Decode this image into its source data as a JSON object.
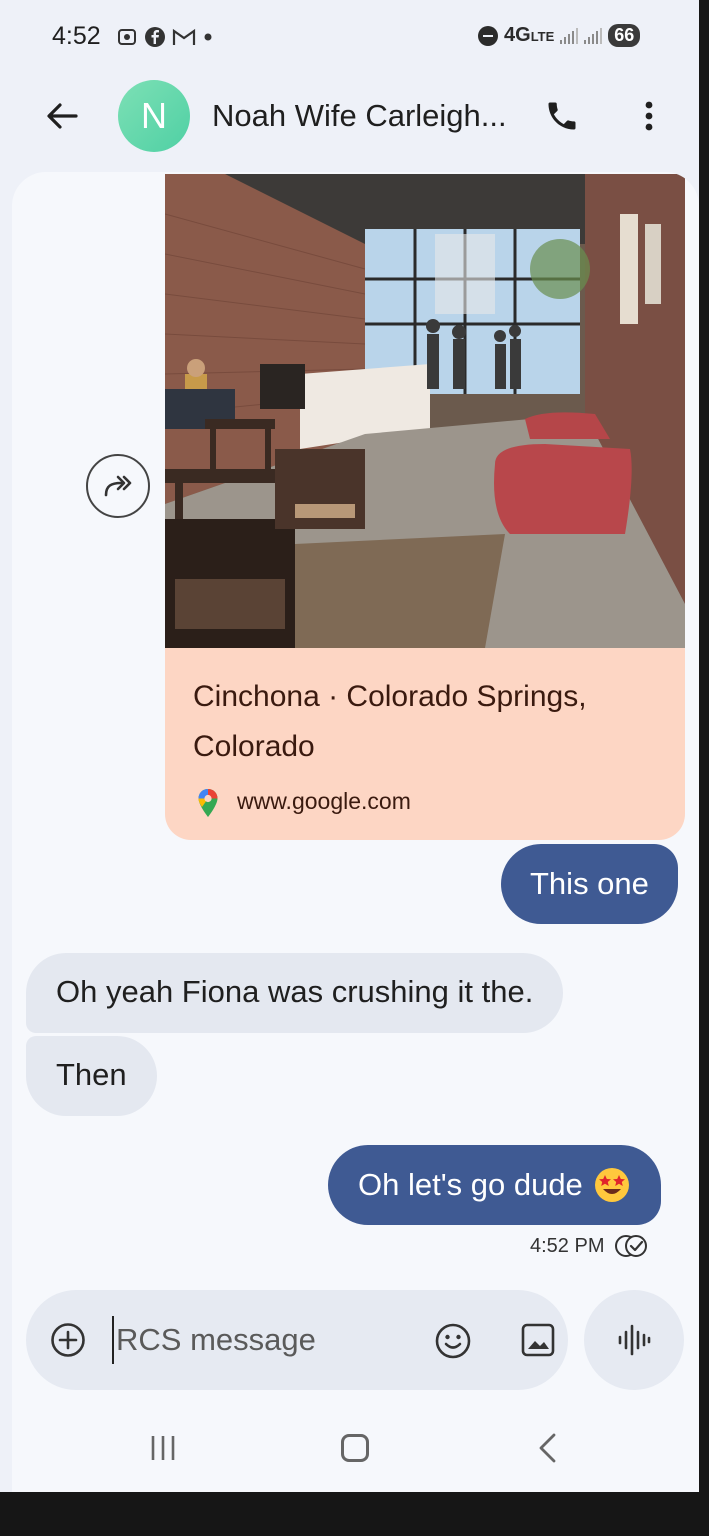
{
  "status_bar": {
    "time": "4:52",
    "network": "4G",
    "network_sub": "LTE",
    "battery": "66"
  },
  "header": {
    "avatar_letter": "N",
    "contact_name": "Noah Wife Carleigh...",
    "avatar_color": "#5fd6a9"
  },
  "link_preview": {
    "title": "Cinchona · Colorado Springs, Colorado",
    "domain": "www.google.com",
    "card_color": "#fdd6c4"
  },
  "messages": [
    {
      "direction": "outgoing",
      "text": "This one"
    },
    {
      "direction": "incoming",
      "text": "Oh yeah Fiona was crushing it the."
    },
    {
      "direction": "incoming",
      "text": "Then"
    },
    {
      "direction": "outgoing",
      "text": "Oh let's go dude"
    }
  ],
  "last_message_time": "4:52 PM",
  "composer": {
    "placeholder": "RCS message"
  },
  "icons": {
    "back": "arrow-back-icon",
    "call": "phone-icon",
    "more": "more-vert-icon",
    "forward": "forward-icon",
    "add": "add-circle-icon",
    "emoji": "emoji-icon",
    "gallery": "gallery-icon",
    "voice": "voice-waveform-icon",
    "read_receipt": "double-check-icon"
  },
  "colors": {
    "outgoing_bubble": "#3f5a93",
    "incoming_bubble": "#e4e8f0"
  }
}
